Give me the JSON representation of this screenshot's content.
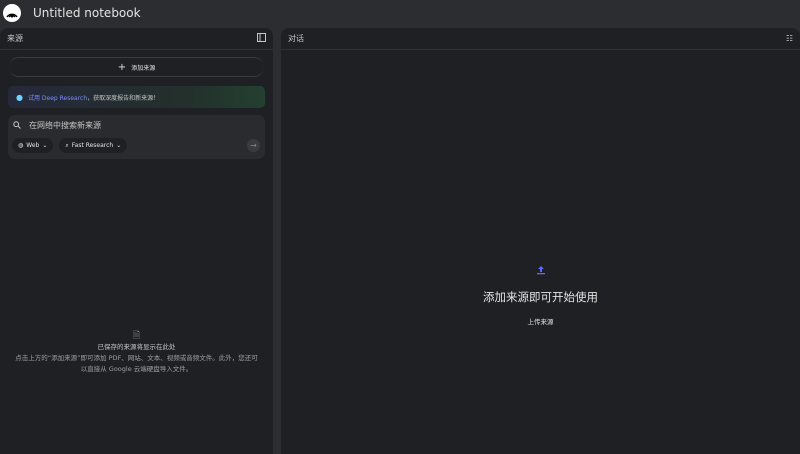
{
  "header": {
    "title": "Untitled notebook"
  },
  "sources": {
    "title": "来源",
    "add_label": "添加来源",
    "banner_link": "试用 Deep Research",
    "banner_text": "，获取深度报告和新来源！",
    "search_placeholder": "在网络中搜索新来源",
    "chip_web": "Web",
    "chip_research": "Fast Research",
    "empty_title": "已保存的来源将显示在此处",
    "empty_line1": "点击上方的“添加来源”即可添加 PDF、网站、文本、视频或音频文件。此外，您还可",
    "empty_line2": "以直接从 Google 云端硬盘导入文件。"
  },
  "chat": {
    "title": "对话",
    "empty_title": "添加来源即可开始使用",
    "upload_label": "上传来源"
  },
  "colors": {
    "accent": "#7c8cff",
    "panel": "#1f2023",
    "background": "#2c2d30"
  }
}
